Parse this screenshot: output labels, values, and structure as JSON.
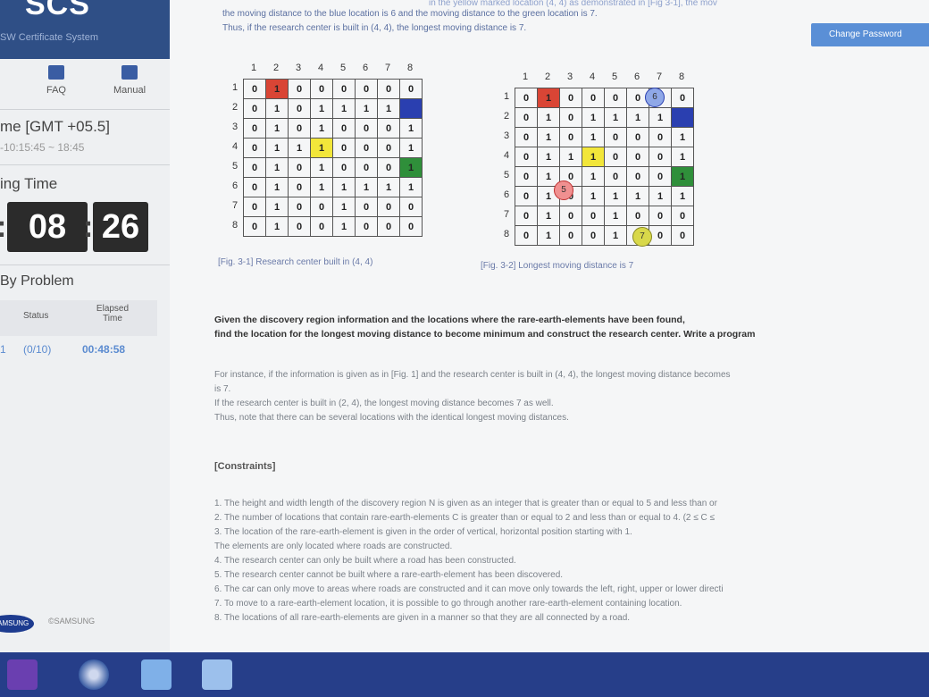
{
  "sidebar": {
    "brand": "SCS",
    "brand_sub": "SW Certificate System",
    "shortcuts": [
      "FAQ",
      "Manual"
    ],
    "gmt": "me [GMT +05.5]",
    "time_range": "-10:15:45 ~ 18:45",
    "remaining_label": "ing Time",
    "timer": {
      "min": "08",
      "sec": "26"
    },
    "by_problem": "By Problem",
    "table_headers": [
      "Status",
      "Elapsed Time"
    ],
    "row": {
      "num": "1",
      "status": "(0/10)",
      "elapsed": "00:48:58"
    },
    "footer": "©SAMSUNG",
    "footer_logo": "SAMSUNG"
  },
  "header": {
    "login": "Change Password"
  },
  "text": {
    "top1": "the moving distance to the blue location is 6 and the moving distance to the green location is 7.",
    "top2": "Thus, if the research center is built in (4, 4), the longest moving distance is 7.",
    "top0": "in the yellow marked location (4, 4) as demonstrated in [Fig 3-1], the mov",
    "cap1": "[Fig. 3-1] Research center built in (4, 4)",
    "cap2": "[Fig. 3-2] Longest moving distance is 7",
    "bold1": "Given the discovery region information and the locations where the rare-earth-elements have been found,",
    "bold2": "find the location for the longest moving distance to become minimum and construct the research center. Write a program",
    "p1": "For instance, if the information is given as in [Fig. 1] and the research center is built in (4, 4), the longest moving distance becomes",
    "p1b": "is 7.",
    "p2": "If the research center is built in (2, 4), the longest moving distance becomes 7 as well.",
    "p3": "Thus, note that there can be several locations with the identical longest moving distances.",
    "constraints": "[Constraints]",
    "items": [
      "1. The height and width length of the discovery region N is given as an integer that is greater than or equal to 5 and less than or",
      "2. The number of locations that contain rare-earth-elements C is greater than or equal to 2 and less than or equal to 4. (2 ≤ C ≤",
      "3. The location of the rare-earth-element is given in the order of vertical, horizontal position starting with 1.",
      "   The elements are only located where roads are constructed.",
      "4. The research center can only be built where a road has been constructed.",
      "5. The research center cannot be built where a rare-earth-element has been discovered.",
      "6. The car can only move to areas where roads are constructed and it can move only towards the left, right, upper or lower directi",
      "7. To move to a rare-earth-element location, it is possible to go through another rare-earth-element containing location.",
      "8. The locations of all rare-earth-elements are given in a manner so that they are all connected by a road."
    ]
  },
  "grid": {
    "rows": [
      [
        "0",
        "1",
        "0",
        "0",
        "0",
        "0",
        "0",
        "0"
      ],
      [
        "0",
        "1",
        "0",
        "1",
        "1",
        "1",
        "1",
        ""
      ],
      [
        "0",
        "1",
        "0",
        "1",
        "0",
        "0",
        "0",
        "1"
      ],
      [
        "0",
        "1",
        "1",
        "1",
        "0",
        "0",
        "0",
        "1"
      ],
      [
        "0",
        "1",
        "0",
        "1",
        "0",
        "0",
        "0",
        "1"
      ],
      [
        "0",
        "1",
        "0",
        "1",
        "1",
        "1",
        "1",
        "1"
      ],
      [
        "0",
        "1",
        "0",
        "0",
        "1",
        "0",
        "0",
        "0"
      ],
      [
        "0",
        "1",
        "0",
        "0",
        "1",
        "0",
        "0",
        "0"
      ]
    ],
    "headers": [
      "1",
      "2",
      "3",
      "4",
      "5",
      "6",
      "7",
      "8"
    ],
    "markers": [
      "6",
      "5",
      "7"
    ]
  },
  "colors": {
    "red": "#d94535",
    "blue": "#2a3fb0",
    "yellow": "#f2e63a",
    "green": "#2f8f3a"
  }
}
